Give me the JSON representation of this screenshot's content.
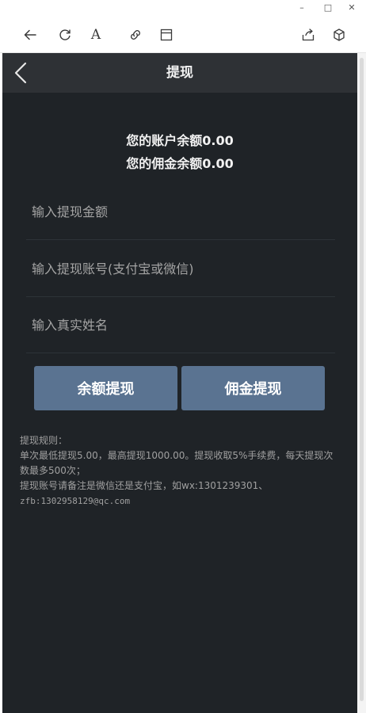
{
  "window_controls": {
    "minimize": "–",
    "maximize": "□",
    "close": "✕"
  },
  "toolbar": {
    "icons": [
      "back-arrow-icon",
      "reload-icon",
      "font-icon",
      "link-icon",
      "reader-icon",
      "share-icon",
      "cube-icon"
    ],
    "font_glyph": "A"
  },
  "header": {
    "title": "提现"
  },
  "balance": {
    "account_text": "您的账户余额0.00",
    "commission_text": "您的佣金余额0.00"
  },
  "form": {
    "amount_placeholder": "输入提现金额",
    "account_placeholder": "输入提现账号(支付宝或微信)",
    "name_placeholder": "输入真实姓名"
  },
  "buttons": {
    "balance_withdraw": "余额提现",
    "commission_withdraw": "佣金提现"
  },
  "rules": {
    "title": "提现规则：",
    "line1": "单次最低提现5.00，最高提现1000.00。提现收取5%手续费，每天提现次数最多500次；",
    "line2": "提现账号请备注是微信还是支付宝，如wx:1301239301、",
    "line3": "zfb:1302958129@qc.com"
  },
  "colors": {
    "app_background": "#1f2327",
    "header_background": "#2e3135",
    "button_background": "#5a7391"
  }
}
